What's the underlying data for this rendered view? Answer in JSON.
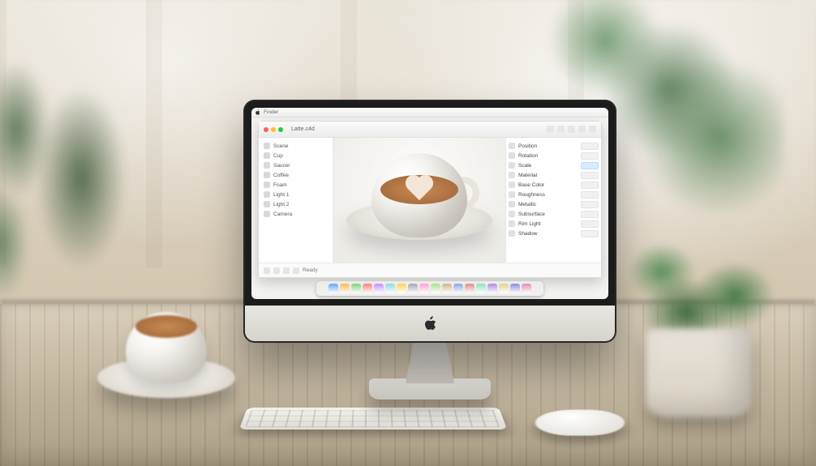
{
  "menubar": {
    "app": "Finder"
  },
  "window": {
    "title": "Latte.c4d",
    "left_items": [
      "Scene",
      "Cup",
      "Saucer",
      "Coffee",
      "Foam",
      "Light 1",
      "Light 2",
      "Camera"
    ],
    "right_items": [
      {
        "label": "Position",
        "highlight": false
      },
      {
        "label": "Rotation",
        "highlight": false
      },
      {
        "label": "Scale",
        "highlight": true
      },
      {
        "label": "Material",
        "highlight": false
      },
      {
        "label": "Base Color",
        "highlight": false
      },
      {
        "label": "Roughness",
        "highlight": false
      },
      {
        "label": "Metallic",
        "highlight": false
      },
      {
        "label": "Subsurface",
        "highlight": false
      },
      {
        "label": "Rim Light",
        "highlight": false
      },
      {
        "label": "Shadow",
        "highlight": false
      }
    ],
    "status": "Ready"
  },
  "dock_count": 18
}
